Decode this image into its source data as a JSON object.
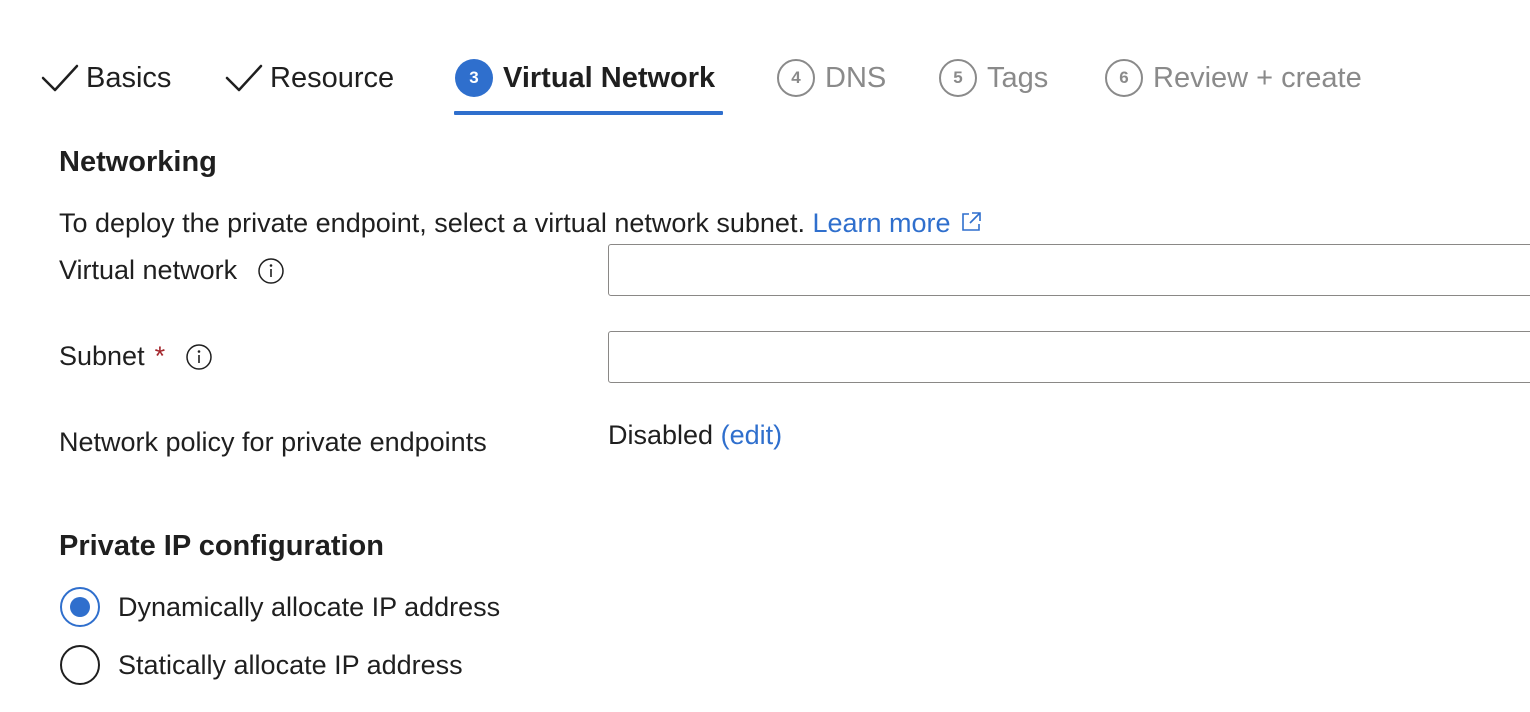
{
  "wizard": {
    "steps": [
      {
        "label": "Basics",
        "state": "done"
      },
      {
        "label": "Resource",
        "state": "done"
      },
      {
        "number": "3",
        "label": "Virtual Network",
        "state": "active"
      },
      {
        "number": "4",
        "label": "DNS",
        "state": "todo"
      },
      {
        "number": "5",
        "label": "Tags",
        "state": "todo"
      },
      {
        "number": "6",
        "label": "Review + create",
        "state": "todo"
      }
    ]
  },
  "networking": {
    "title": "Networking",
    "description": "To deploy the private endpoint, select a virtual network subnet.",
    "learn_more": "Learn more",
    "virtual_network_label": "Virtual network",
    "virtual_network_value": "",
    "subnet_label": "Subnet",
    "subnet_required": "*",
    "subnet_value": "",
    "policy_label": "Network policy for private endpoints",
    "policy_value": "Disabled",
    "policy_edit": "(edit)"
  },
  "ip_config": {
    "title": "Private IP configuration",
    "options": [
      {
        "label": "Dynamically allocate IP address",
        "selected": true
      },
      {
        "label": "Statically allocate IP address",
        "selected": false
      }
    ]
  },
  "colors": {
    "accent": "#2f6fcd",
    "required": "#a4262c",
    "disabled_text": "#8a8a8a"
  },
  "icons": [
    "check-icon",
    "info-icon",
    "external-link-icon"
  ]
}
